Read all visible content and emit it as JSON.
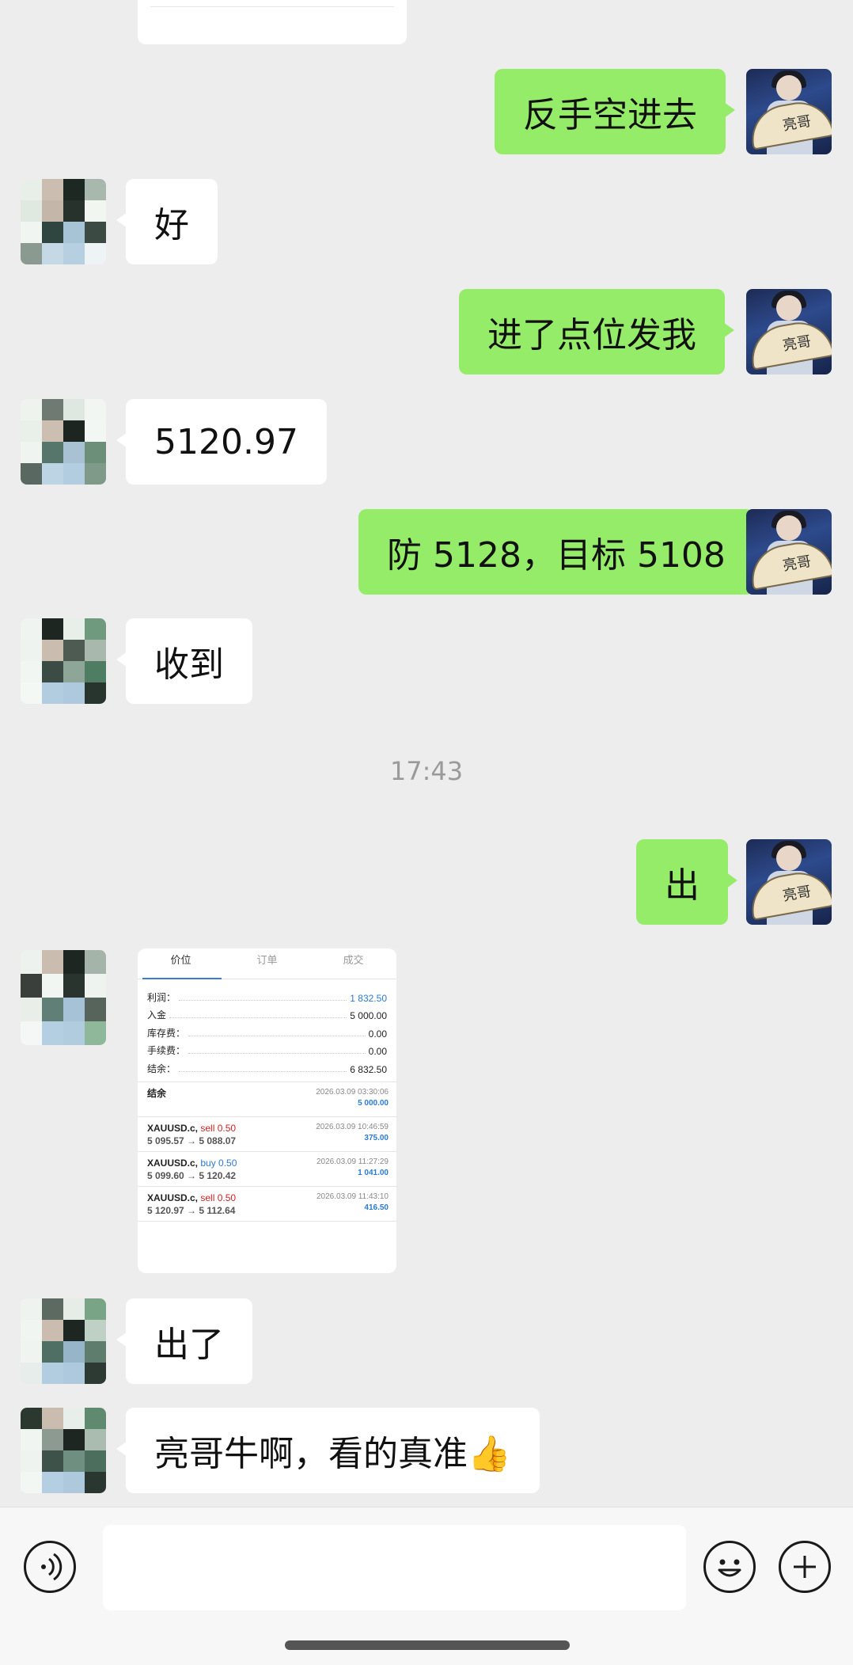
{
  "messages": [
    {
      "side": "self",
      "text": "反手空进去"
    },
    {
      "side": "other",
      "text": "好"
    },
    {
      "side": "self",
      "text": "进了点位发我"
    },
    {
      "side": "other",
      "text": "5120.97"
    },
    {
      "side": "self",
      "text": "防 5128，目标 5108"
    },
    {
      "side": "other",
      "text": "收到"
    },
    {
      "side": "self",
      "text": "出"
    },
    {
      "side": "other",
      "text": "出了"
    },
    {
      "side": "other",
      "text": "亮哥牛啊，看的真准👍"
    }
  ],
  "timestamp": "17:43",
  "self_avatar": {
    "fan_text": "亮哥"
  },
  "trade_card": {
    "tabs": [
      "价位",
      "订单",
      "成交"
    ],
    "summary": [
      {
        "label": "利润：",
        "value": "1 832.50",
        "accent": "blue"
      },
      {
        "label": "入金",
        "value": "5 000.00"
      },
      {
        "label": "库存费：",
        "value": "0.00"
      },
      {
        "label": "手续费：",
        "value": "0.00"
      },
      {
        "label": "结余：",
        "value": "6 832.50"
      }
    ],
    "balance_entry": {
      "title": "结余",
      "time": "2026.03.09 03:30:06",
      "amount": "5 000.00"
    },
    "deals": [
      {
        "symbol": "XAUUSD.c,",
        "action": "sell 0.50",
        "action_color": "red",
        "prices": "5 095.57 → 5 088.07",
        "time": "2026.03.09 10:46:59",
        "profit": "375.00"
      },
      {
        "symbol": "XAUUSD.c,",
        "action": "buy 0.50",
        "action_color": "blue",
        "prices": "5 099.60 → 5 120.42",
        "time": "2026.03.09 11:27:29",
        "profit": "1 041.00"
      },
      {
        "symbol": "XAUUSD.c,",
        "action": "sell 0.50",
        "action_color": "red",
        "prices": "5 120.97 → 5 112.64",
        "time": "2026.03.09 11:43:10",
        "profit": "416.50"
      }
    ]
  },
  "input_bar": {
    "voice_icon": "voice-icon",
    "emoji_icon": "emoji-icon",
    "plus_icon": "plus-icon"
  },
  "colors": {
    "self_bubble": "#95ec69",
    "other_bubble": "#ffffff",
    "background": "#ededed"
  }
}
